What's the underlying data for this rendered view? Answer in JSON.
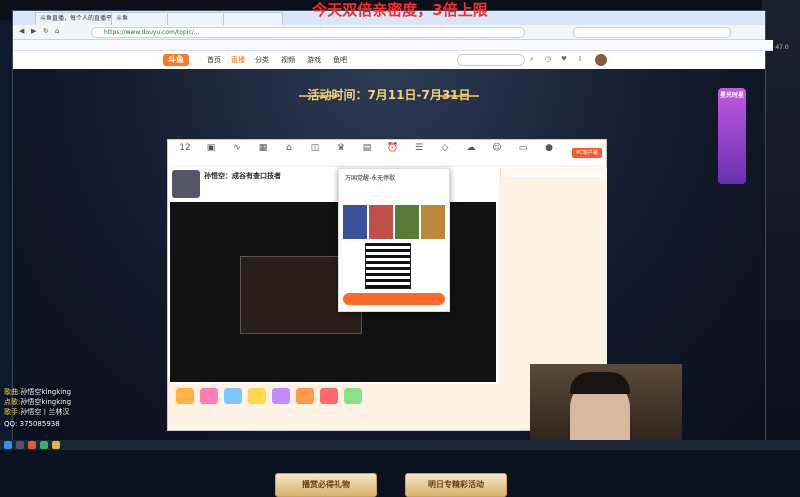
{
  "overlay": {
    "title": "今天双倍亲密度，3倍上限"
  },
  "browser": {
    "tabs": [
      "斗鱼直播，每个人的直播平台",
      "斗鱼",
      "",
      ""
    ],
    "url": "https://www.douyu.com/topic/...",
    "search_placeholder": "",
    "bookmarks": "",
    "net_speed": "47.0"
  },
  "site_nav": {
    "logo": "斗鱼",
    "links": [
      "首页",
      "直播",
      "分类",
      "视频",
      "游戏",
      "鱼吧"
    ],
    "search_placeholder": ""
  },
  "event": {
    "time": "活动时间：7月11日-7月31日",
    "bottom_buttons": [
      "播赏必得礼物",
      "明日专精彩活动"
    ]
  },
  "panel": {
    "tools": [
      "",
      "",
      "",
      "",
      "",
      "",
      "",
      "",
      "",
      "",
      "",
      "",
      "",
      "",
      ""
    ],
    "count": "12",
    "pc_button": "PC客户端",
    "streamer_title": "孙悟空：成谷有查口技者",
    "popup_title": "万国觉醒-永无停歇",
    "popup_button": ""
  },
  "promo": {
    "text": "星光时星"
  },
  "music": {
    "rows": [
      {
        "label": "歌曲:",
        "value": "孙悟空kingking"
      },
      {
        "label": "点歌:",
        "value": "孙悟空kingking"
      },
      {
        "label": "歌手:",
        "value": "孙悟空丨兰林汉"
      }
    ],
    "qq": "QQ: 375085938",
    "counter": ""
  },
  "taskbar": {
    "clock": ""
  }
}
